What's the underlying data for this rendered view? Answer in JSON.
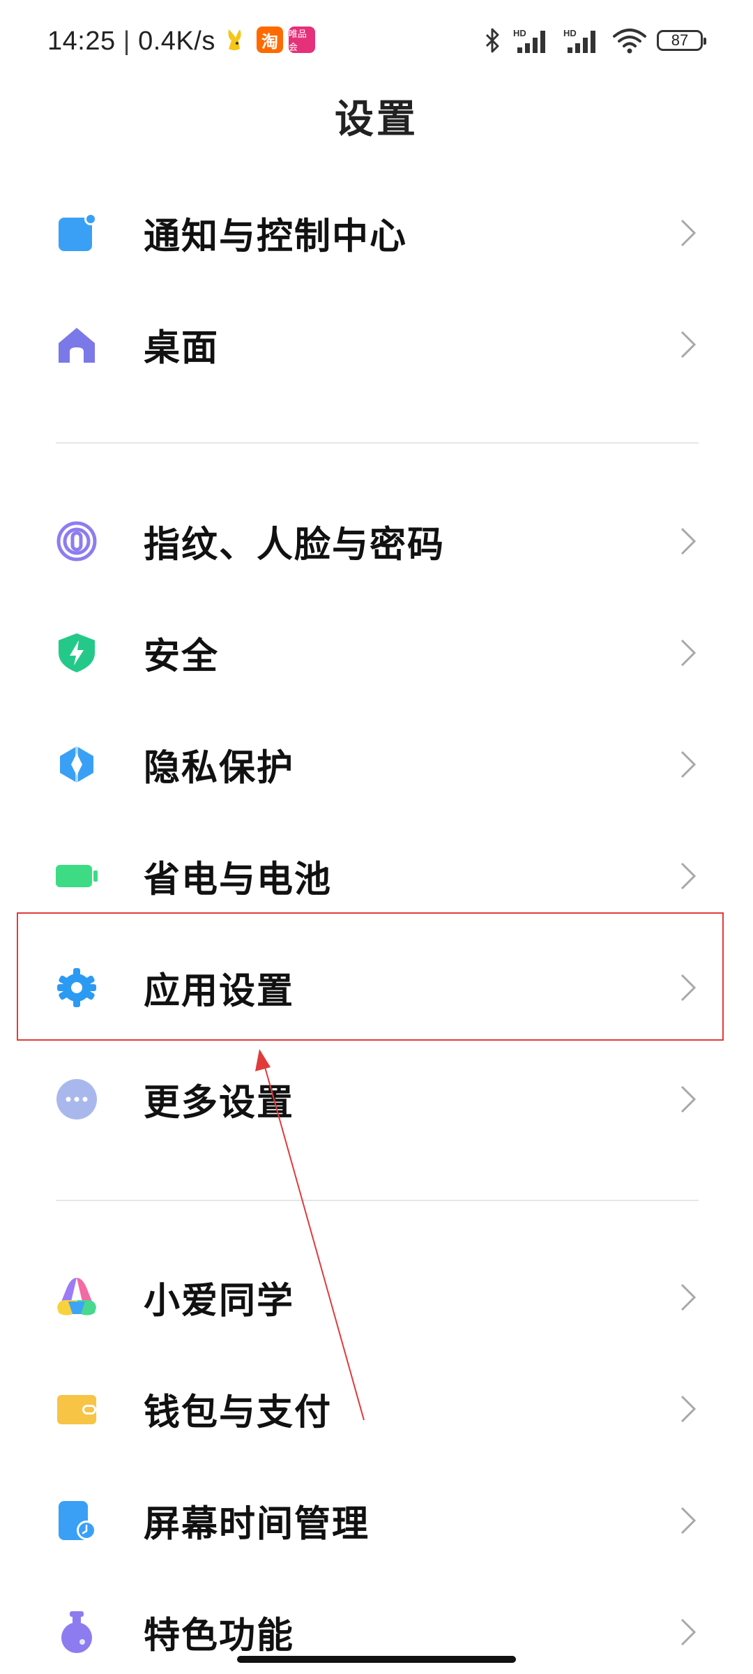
{
  "status_bar": {
    "time": "14:25",
    "separator": "|",
    "net_speed": "0.4K/s",
    "battery_level": "87",
    "signal_tag_1": "HD",
    "signal_tag_2": "HD",
    "notification_apps": [
      "rabbit-app-icon",
      "taobao-icon",
      "vipshop-icon"
    ],
    "taobao_glyph": "淘",
    "vipshop_logo_text": "唯品会"
  },
  "page": {
    "title": "设置"
  },
  "settings": {
    "items": [
      {
        "label": "通知与控制中心",
        "icon": "notification-icon",
        "color": "#3aa0f5"
      },
      {
        "label": "桌面",
        "icon": "home-icon",
        "color": "#7b78e8"
      },
      {
        "label": "指纹、人脸与密码",
        "icon": "fingerprint-icon",
        "color": "#8d7cf0"
      },
      {
        "label": "安全",
        "icon": "shield-icon",
        "color": "#24c98a"
      },
      {
        "label": "隐私保护",
        "icon": "privacy-icon",
        "color": "#3aa0f5"
      },
      {
        "label": "省电与电池",
        "icon": "battery-icon",
        "color": "#3ddc84"
      },
      {
        "label": "应用设置",
        "icon": "gear-icon",
        "color": "#2b9af3"
      },
      {
        "label": "更多设置",
        "icon": "more-icon",
        "color": "#9fb3e8"
      },
      {
        "label": "小爱同学",
        "icon": "xiaoai-icon",
        "color": "#f46aa2"
      },
      {
        "label": "钱包与支付",
        "icon": "wallet-icon",
        "color": "#f7c445"
      },
      {
        "label": "屏幕时间管理",
        "icon": "screen-time-icon",
        "color": "#3aa0f5"
      },
      {
        "label": "特色功能",
        "icon": "potion-icon",
        "color": "#8d7cf0"
      }
    ]
  },
  "annotation": {
    "highlighted_item": "应用设置",
    "color": "#e13a3a"
  }
}
